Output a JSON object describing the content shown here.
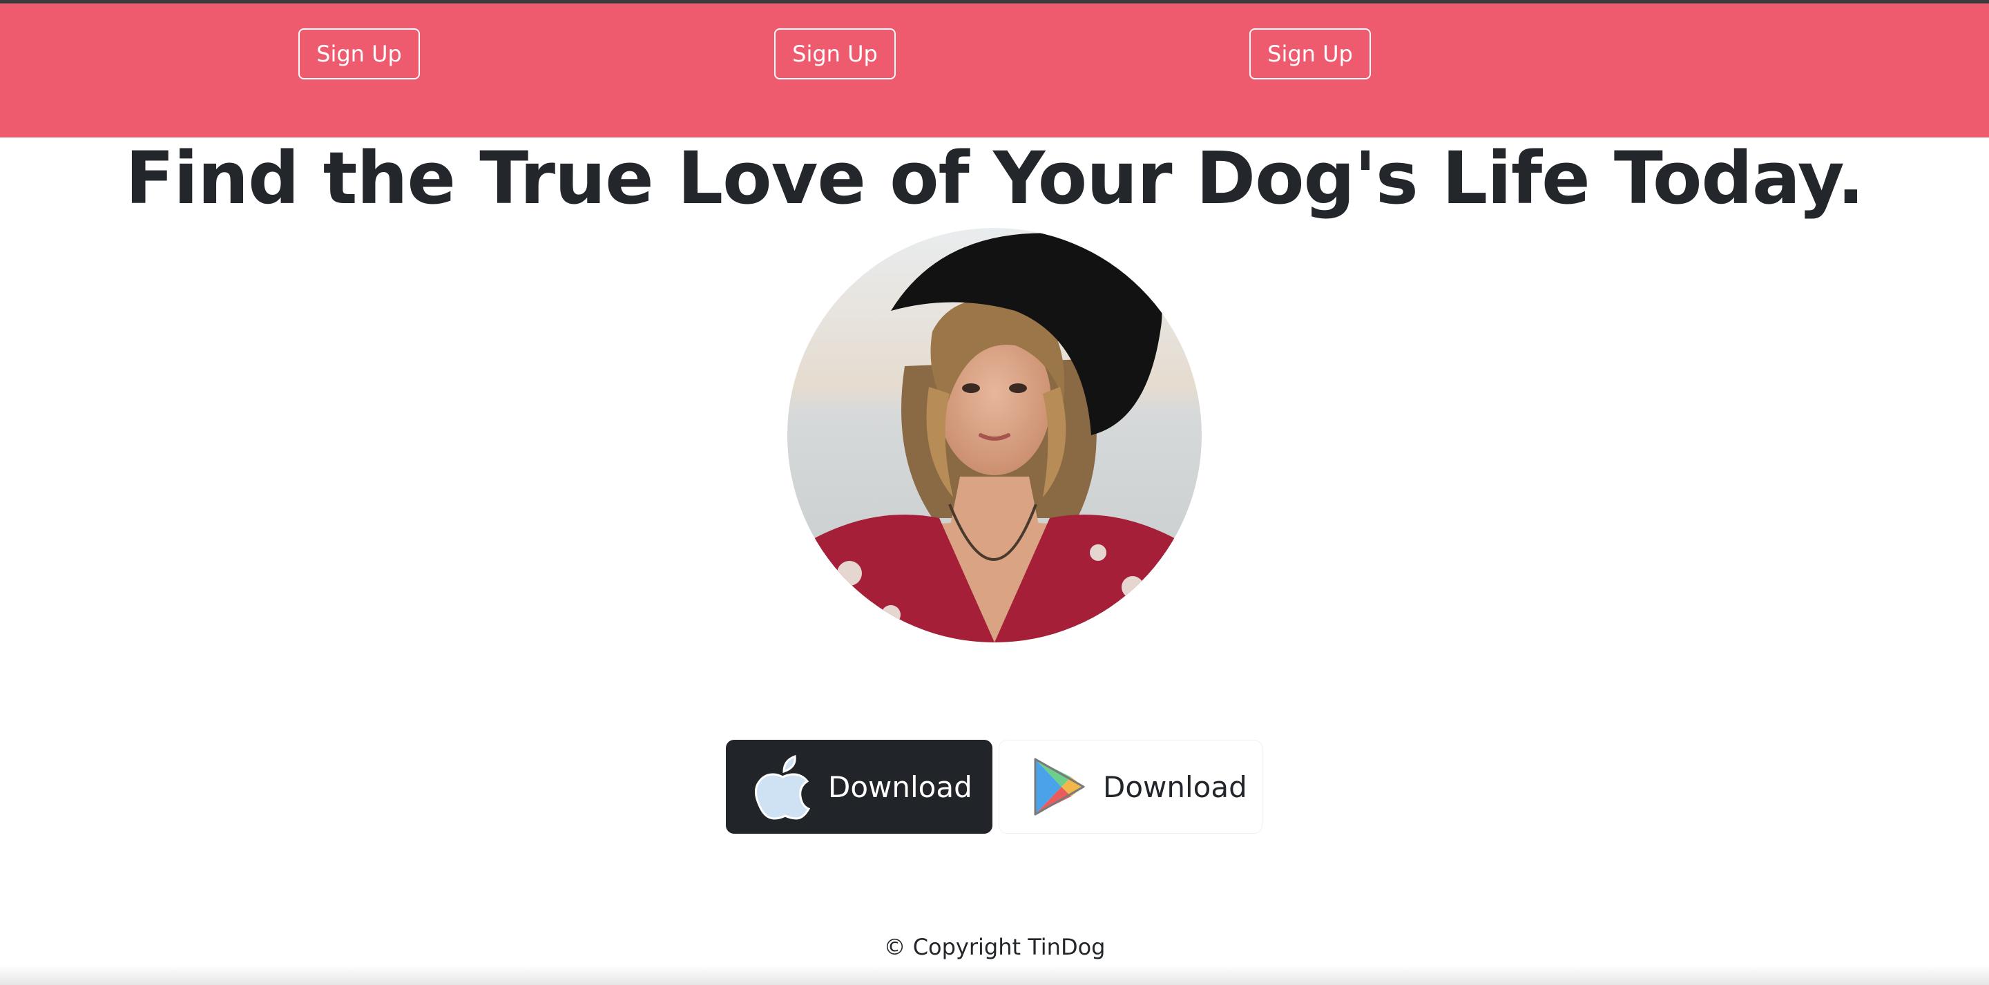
{
  "pricing": {
    "buttons": [
      "Sign Up",
      "Sign Up",
      "Sign Up"
    ]
  },
  "hero": {
    "title": "Find the True Love of Your Dog's Life Today.",
    "avatar_image": "portrait of woman in black hat"
  },
  "downloads": {
    "apple": {
      "label": "Download",
      "icon": "apple-icon"
    },
    "google": {
      "label": "Download",
      "icon": "google-play-icon"
    }
  },
  "footer": {
    "copyright": "© Copyright TinDog"
  },
  "colors": {
    "brand": "#ef5b6e",
    "dark": "#212428",
    "text": "#23262b"
  }
}
